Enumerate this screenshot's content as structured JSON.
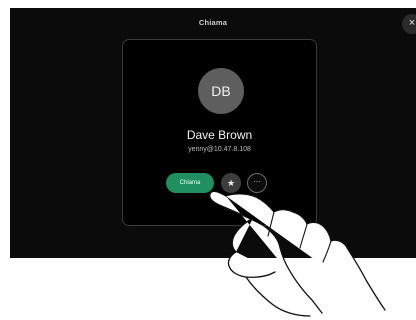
{
  "window": {
    "title": "Chiama",
    "close_icon": "×"
  },
  "contact": {
    "initials": "DB",
    "name": "Dave Brown",
    "address": "yenny@10.47.8.108"
  },
  "actions": {
    "call_label": "Chiama",
    "favorite_icon": "★",
    "more_icon": "···"
  },
  "colors": {
    "screen_background": "#0b0b0b",
    "call_button": "#1f8f5f",
    "avatar": "#5e5e5e"
  }
}
